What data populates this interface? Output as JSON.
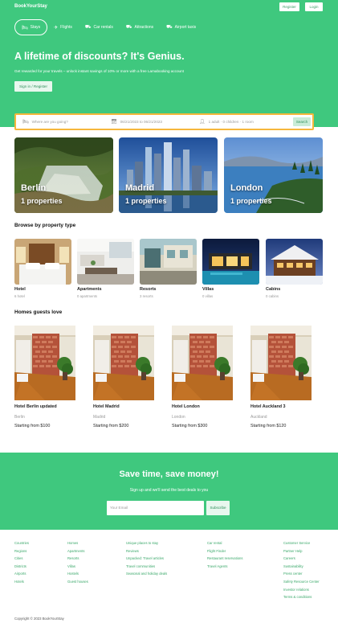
{
  "header": {
    "brand": "BookYourStay",
    "register_label": "Register",
    "login_label": "Login"
  },
  "nav": [
    {
      "label": "Stays",
      "icon": "bed-icon",
      "active": true
    },
    {
      "label": "Flights",
      "icon": "plane-icon",
      "active": false
    },
    {
      "label": "Car rentals",
      "icon": "car-icon",
      "active": false
    },
    {
      "label": "Attractions",
      "icon": "taxi-icon",
      "active": false
    },
    {
      "label": "Airport taxis",
      "icon": "taxi-icon",
      "active": false
    }
  ],
  "hero": {
    "title": "A lifetime of discounts? It's Genius.",
    "subtitle": "Get rewarded for your travels – unlock instant savings of 10% or more with a free Lamabooking account",
    "signin_label": "Sign in / Register"
  },
  "search": {
    "destination_placeholder": "Where are you going?",
    "dates": "06/21/2023 to 06/21/2023",
    "guests": "1 adult · 0 children · 1 room",
    "button_label": "Search"
  },
  "cities": [
    {
      "name": "Berlin",
      "count": "1 properties"
    },
    {
      "name": "Madrid",
      "count": "1 properties"
    },
    {
      "name": "London",
      "count": "1 properties"
    }
  ],
  "property_types": {
    "title": "Browse by property type",
    "items": [
      {
        "name": "Hotel",
        "count": "6 hotel"
      },
      {
        "name": "Apartments",
        "count": "0 apartments"
      },
      {
        "name": "Resorts",
        "count": "3 resorts"
      },
      {
        "name": "Villas",
        "count": "0 villas"
      },
      {
        "name": "Cabins",
        "count": "0 cabins"
      }
    ]
  },
  "homes": {
    "title": "Homes guests love",
    "items": [
      {
        "name": "Hotel Berlin updated",
        "city": "Berlin",
        "price": "Starting from $100"
      },
      {
        "name": "Hotel Madrid",
        "city": "Madrid",
        "price": "Starting from $200"
      },
      {
        "name": "Hotel London",
        "city": "London",
        "price": "Starting from $300"
      },
      {
        "name": "Hotel Auckland 3",
        "city": "Auckland",
        "price": "Starting from $120"
      }
    ]
  },
  "newsletter": {
    "title": "Save time, save money!",
    "subtitle": "Sign up and we'll send the best deals to you",
    "email_placeholder": "Your Email",
    "button_label": "Subscribe"
  },
  "footer": {
    "columns": [
      [
        "Countries",
        "Regions",
        "Cities",
        "Districts",
        "Airports",
        "Hotels"
      ],
      [
        "Homes",
        "Apartments",
        "Resorts",
        "Villas",
        "Hostels",
        "Guest houses"
      ],
      [
        "Unique places to stay",
        "Reviews",
        "Unpacked: Travel articles",
        "Travel communities",
        "Seasonal and holiday deals"
      ],
      [
        "Car rental",
        "Flight Finder",
        "Restaurant reservations",
        "Travel Agents"
      ],
      [
        "Customer Service",
        "Partner Help",
        "Careers",
        "Sustainability",
        "Press center",
        "Safety Resource Center",
        "Investor relations",
        "Terms & conditions"
      ]
    ],
    "copyright": "Copyright © 2023 BookYourStay"
  },
  "colors": {
    "brand_green": "#3fc87e",
    "search_border": "#f6b73c",
    "link_green": "#3aa86a"
  }
}
